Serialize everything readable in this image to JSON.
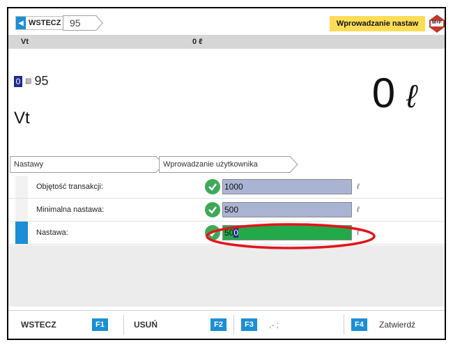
{
  "header": {
    "back_label": "WSTECZ",
    "breadcrumb": "95",
    "mode": "Wprowadzanie nastaw",
    "logo_text": "M+F",
    "logo_color": "#c0392b",
    "accent_color": "#1a8fd6",
    "badge_color": "#fddc56"
  },
  "infobar": {
    "key": "Vt",
    "value": "0 ℓ"
  },
  "display": {
    "nozzle_number": "0",
    "pump_icon": "nozzle-icon",
    "fuel": "95",
    "product": "Vt",
    "volume": "0",
    "volume_unit": "ℓ"
  },
  "tabs": [
    {
      "label": "Nastawy"
    },
    {
      "label": "Wprowadzanie użytkownika"
    }
  ],
  "rows": [
    {
      "label": "Objętość transakcji:",
      "value": "1000",
      "cursor": "",
      "unit": "ℓ",
      "active": false
    },
    {
      "label": "Minimalna nastawa:",
      "value": "500",
      "cursor": "",
      "unit": "ℓ",
      "active": false
    },
    {
      "label": "Nastawa:",
      "value": "50",
      "cursor": "0",
      "unit": "ℓ",
      "active": true
    }
  ],
  "footer": [
    {
      "label": "WSTECZ",
      "key": "F1"
    },
    {
      "label": "USUŃ",
      "key": "F2"
    },
    {
      "label": ",- ;",
      "key": "F3"
    },
    {
      "label": "Zatwierdź",
      "key": "F4"
    }
  ],
  "annotation_color": "#e3141b"
}
